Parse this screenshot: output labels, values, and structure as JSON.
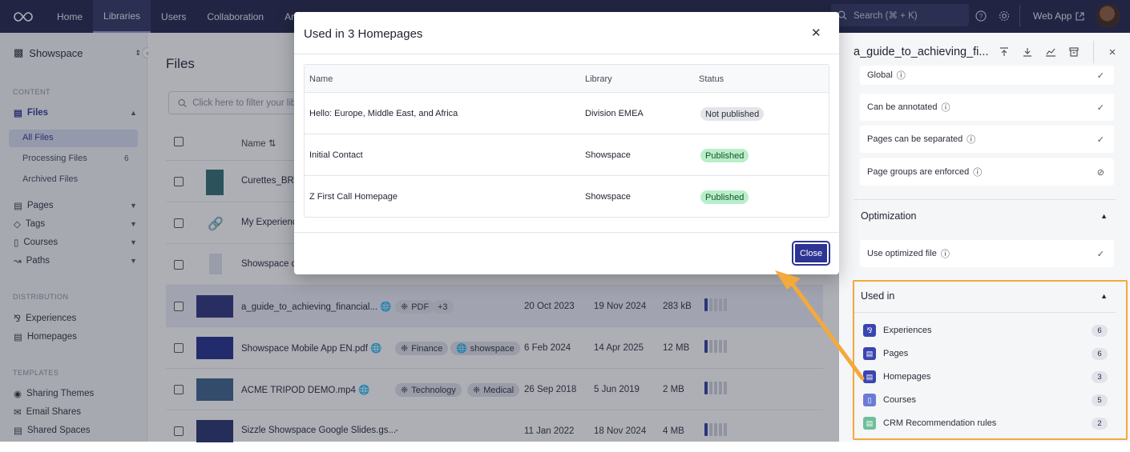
{
  "topbar": {
    "nav": [
      "Home",
      "Libraries",
      "Users",
      "Collaboration",
      "Analytics"
    ],
    "search_placeholder": "Search (⌘ + K)",
    "web_app": "Web App"
  },
  "sidebar": {
    "workspace": "Showspace",
    "content_title": "CONTENT",
    "files": "Files",
    "all_files": "All Files",
    "processing_files": "Processing Files",
    "processing_count": "6",
    "archived_files": "Archived Files",
    "pages": "Pages",
    "tags": "Tags",
    "courses": "Courses",
    "paths": "Paths",
    "distribution_title": "DISTRIBUTION",
    "experiences": "Experiences",
    "homepages": "Homepages",
    "templates_title": "TEMPLATES",
    "sharing_themes": "Sharing Themes",
    "email_shares": "Email Shares",
    "shared_spaces": "Shared Spaces"
  },
  "main": {
    "title": "Files",
    "filter_placeholder": "Click here to filter your library",
    "col_name": "Name",
    "rows": [
      {
        "name": "Curettes_BRC",
        "thumb": "#2f6b6f"
      },
      {
        "name": "My Experience",
        "thumb": "link"
      },
      {
        "name": "Showspace de",
        "thumb": "#dfe3ec"
      },
      {
        "name": "a_guide_to_achieving_financial...",
        "tags": [
          "PDF",
          "+3"
        ],
        "created": "20 Oct 2023",
        "updated": "19 Nov 2024",
        "size": "283 kB",
        "thumb": "#2a2f7a"
      },
      {
        "name": "Showspace Mobile App EN.pdf",
        "tags": [
          "Finance",
          "showspace"
        ],
        "created": "6 Feb 2024",
        "updated": "14 Apr 2025",
        "size": "12 MB",
        "thumb": "#1f2c8a"
      },
      {
        "name": "ACME TRIPOD DEMO.mp4",
        "tags": [
          "Technology",
          "Medical"
        ],
        "created": "26 Sep 2018",
        "updated": "5 Jun 2019",
        "size": "2 MB",
        "thumb": "#3b5f8a"
      },
      {
        "name": "Sizzle Showspace Google Slides.gs...",
        "tags": [
          "-"
        ],
        "created": "11 Jan 2022",
        "updated": "18 Nov 2024",
        "size": "4 MB",
        "thumb": "#24306b"
      }
    ]
  },
  "rpanel": {
    "title": "a_guide_to_achieving_fi...",
    "cards": [
      "Global",
      "Can be annotated",
      "Pages can be separated",
      "Page groups are enforced"
    ],
    "optimization": "Optimization",
    "optimized": "Use optimized file",
    "used_in": "Used in",
    "used_items": [
      {
        "label": "Experiences",
        "count": "6",
        "color": "#3a45b0"
      },
      {
        "label": "Pages",
        "count": "6",
        "color": "#3a45b0"
      },
      {
        "label": "Homepages",
        "count": "3",
        "color": "#3a45b0"
      },
      {
        "label": "Courses",
        "count": "5",
        "color": "#6c7bd6"
      },
      {
        "label": "CRM Recommendation rules",
        "count": "2",
        "color": "#6fbf9a"
      }
    ]
  },
  "modal": {
    "title": "Used in 3 Homepages",
    "col_name": "Name",
    "col_library": "Library",
    "col_status": "Status",
    "rows": [
      {
        "name": "Hello: Europe, Middle East, and Africa",
        "library": "Division EMEA",
        "status": "Not published",
        "published": false
      },
      {
        "name": "Initial Contact",
        "library": "Showspace",
        "status": "Published",
        "published": true
      },
      {
        "name": "Z First Call Homepage",
        "library": "Showspace",
        "status": "Published",
        "published": true
      }
    ],
    "close": "Close"
  }
}
